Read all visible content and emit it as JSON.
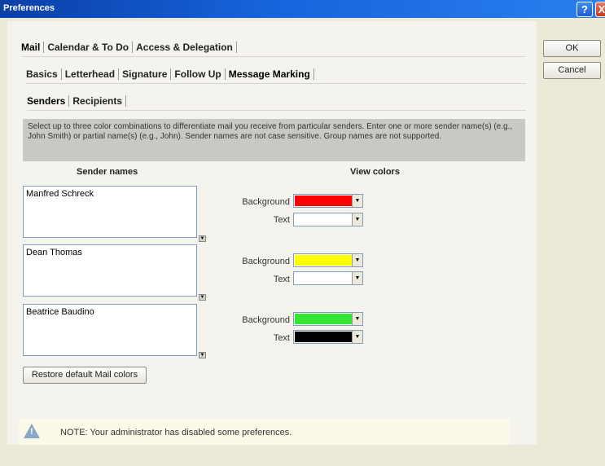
{
  "window": {
    "title": "Preferences"
  },
  "titlebar_buttons": {
    "help": "?",
    "close": "X"
  },
  "tabs_level1": [
    "Mail",
    "Calendar & To Do",
    "Access & Delegation"
  ],
  "tabs_level2": [
    "Basics",
    "Letterhead",
    "Signature",
    "Follow Up",
    "Message Marking"
  ],
  "tabs_level3": [
    "Senders",
    "Recipients"
  ],
  "description": "Select up to three color combinations to differentiate mail you receive from particular senders. Enter one or more sender name(s) (e.g., John Smith) or partial name(s) (e.g., John). Sender names are not case sensitive.  Group names are not supported.",
  "columns": {
    "sender_names": "Sender names",
    "view_colors": "View colors"
  },
  "labels": {
    "background": "Background",
    "text": "Text"
  },
  "senders": [
    {
      "name": "Manfred Schreck",
      "background": "#ff0000",
      "text": "#ffffff"
    },
    {
      "name": "Dean Thomas",
      "background": "#ffff00",
      "text": "#ffffff"
    },
    {
      "name": "Beatrice Baudino",
      "background": "#33e633",
      "text": "#000000"
    }
  ],
  "buttons": {
    "ok": "OK",
    "cancel": "Cancel",
    "restore": "Restore default Mail colors"
  },
  "note": "NOTE: Your administrator has disabled some preferences.",
  "icons": {
    "warning": "warning-icon",
    "dropdown": "chevron-down-icon",
    "spinner": "scroll-down-icon"
  }
}
